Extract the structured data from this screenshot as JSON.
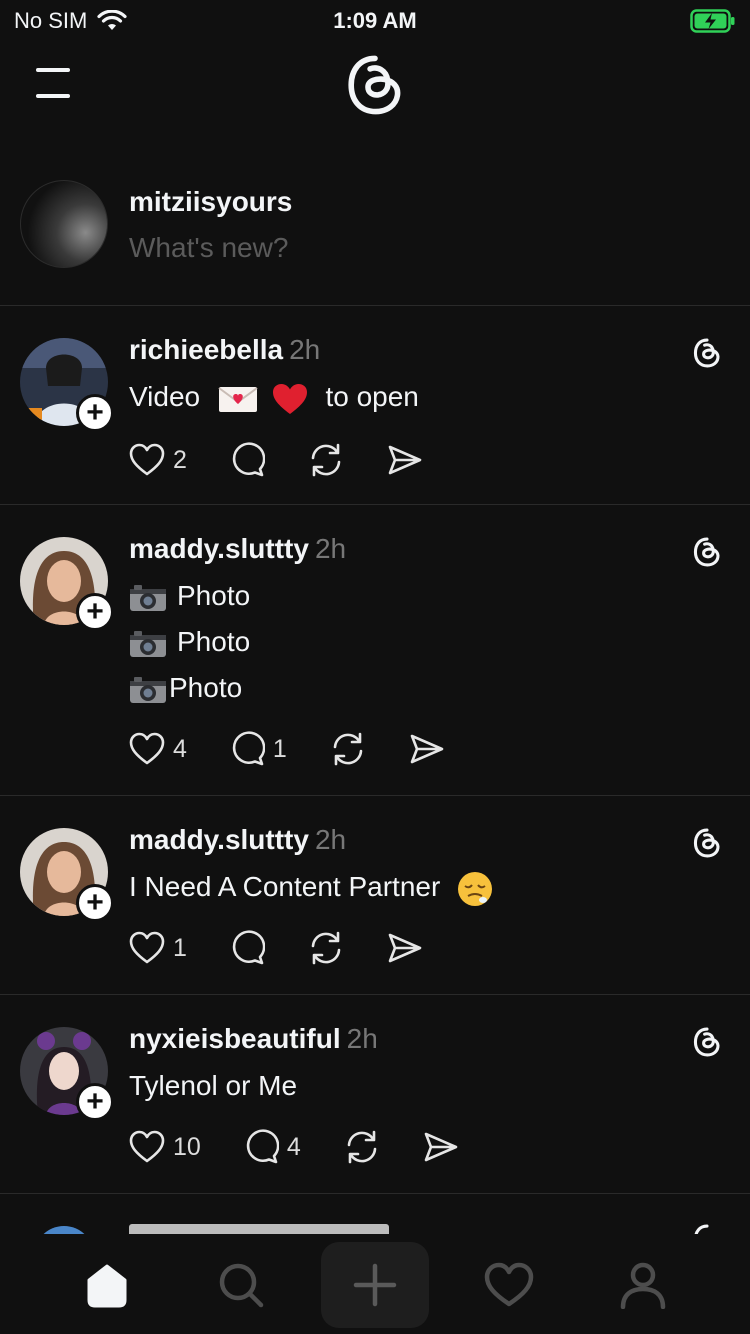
{
  "status_bar": {
    "carrier": "No SIM",
    "time": "1:09 AM",
    "battery_color": "#30d158"
  },
  "header": {
    "menu_icon": "hamburger-icon",
    "logo_icon": "threads-logo-icon"
  },
  "composer": {
    "username": "mitziisyours",
    "placeholder": "What's new?"
  },
  "posts": [
    {
      "username": "richieebella",
      "time": "2h",
      "lines": [
        "Video",
        "to open"
      ],
      "likes": "2",
      "replies": ""
    },
    {
      "username": "maddy.sluttty",
      "time": "2h",
      "lines": [
        "Photo",
        "Photo",
        "Photo"
      ],
      "likes": "4",
      "replies": "1"
    },
    {
      "username": "maddy.sluttty",
      "time": "2h",
      "lines": [
        "I Need A Content Partner"
      ],
      "likes": "1",
      "replies": ""
    },
    {
      "username": "nyxieisbeautiful",
      "time": "2h",
      "lines": [
        "Tylenol or Me"
      ],
      "likes": "10",
      "replies": "4"
    }
  ],
  "tabbar": {
    "items": [
      "home-icon",
      "search-icon",
      "compose-icon",
      "activity-heart-icon",
      "profile-icon"
    ],
    "active": "home-icon"
  }
}
